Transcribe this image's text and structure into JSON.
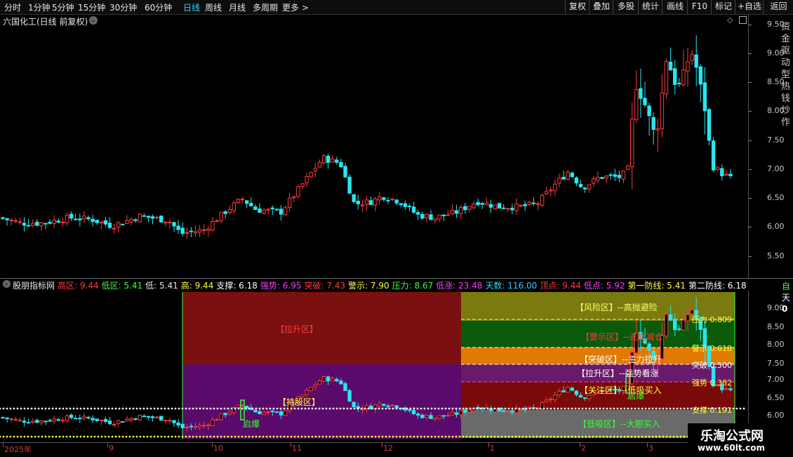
{
  "topbar": {
    "periods": [
      "分时",
      "1分钟",
      "5分钟",
      "15分钟",
      "30分钟",
      "60分钟",
      "日线",
      "周线",
      "月线",
      "多周期",
      "更多 >"
    ],
    "active_period": "日线",
    "right_buttons": [
      "复权",
      "叠加",
      "多股",
      "统计",
      "画线",
      "F10",
      "标记",
      "+自选",
      "返回"
    ]
  },
  "chart": {
    "title": "六国化工(日线 前复权)",
    "price_axis": [
      "9.50",
      "9.00",
      "8.50",
      "8.00",
      "7.50",
      "7.00",
      "6.50",
      "6.00",
      "5.50"
    ],
    "ind_axis": [
      "9.00",
      "8.50",
      "8.00",
      "7.50",
      "7.00",
      "6.50",
      "6.00"
    ],
    "date_labels": [
      "2025年",
      "9",
      "10",
      "11",
      "12",
      "1",
      "2",
      "3"
    ],
    "side_text": "资 金 驱 动 型 热 钱 炒 作",
    "colors": {
      "up": "#ff3b3b",
      "down": "#29e6f0"
    }
  },
  "indicator": {
    "name": "股朋指标网",
    "values": [
      {
        "label": "高区:",
        "value": "9.44",
        "color": "#ff3b3b"
      },
      {
        "label": "低区:",
        "value": "5.41",
        "color": "#3bff3b"
      },
      {
        "label": "低:",
        "value": "5.41",
        "color": "#e6e6e6"
      },
      {
        "label": "高:",
        "value": "9.44",
        "color": "#ffff3b"
      },
      {
        "label": "支撑:",
        "value": "6.18",
        "color": "#ffffff"
      },
      {
        "label": "强势:",
        "value": "6.95",
        "color": "#ff3bff"
      },
      {
        "label": "突破:",
        "value": "7.43",
        "color": "#ff3b3b"
      },
      {
        "label": "警示:",
        "value": "7.90",
        "color": "#ffff3b"
      },
      {
        "label": "压力:",
        "value": "8.67",
        "color": "#3bff3b"
      },
      {
        "label": "低涨:",
        "value": "23.48",
        "color": "#ff3bff"
      },
      {
        "label": "天数:",
        "value": "116.00",
        "color": "#29d3ff"
      },
      {
        "label": "顶点:",
        "value": "9.44",
        "color": "#ff3b3b"
      },
      {
        "label": "低点:",
        "value": "5.92",
        "color": "#ff3bff"
      },
      {
        "label": "第一防线:",
        "value": "5.41",
        "color": "#ffff3b"
      },
      {
        "label": "第二防线:",
        "value": "6.18",
        "color": "#ffffff"
      }
    ],
    "zones": {
      "lasheng_left": "【拉升区】",
      "chigu": "【持股区】",
      "fengxian": "【风险区】--高抛避险",
      "jingshi": "【警示区】--逢高减仓",
      "tupo": "【突破区】--主力拉升",
      "lasheng": "【拉升区】--强势看涨",
      "guanzhu": "【关注区】--低吸买入",
      "dixi": "【低吸区】--大胆买入"
    },
    "levels": [
      {
        "label": "压力 0.809"
      },
      {
        "label": "警示 0.618"
      },
      {
        "label": "突破 0.500"
      },
      {
        "label": "强势 0.382"
      },
      {
        "label": "支撑 0.191"
      }
    ],
    "qibao": "启爆",
    "side_right": [
      "自",
      "天",
      "0"
    ]
  },
  "watermark": {
    "line1": "乐淘公式网",
    "line2": "www.60lt.com"
  }
}
